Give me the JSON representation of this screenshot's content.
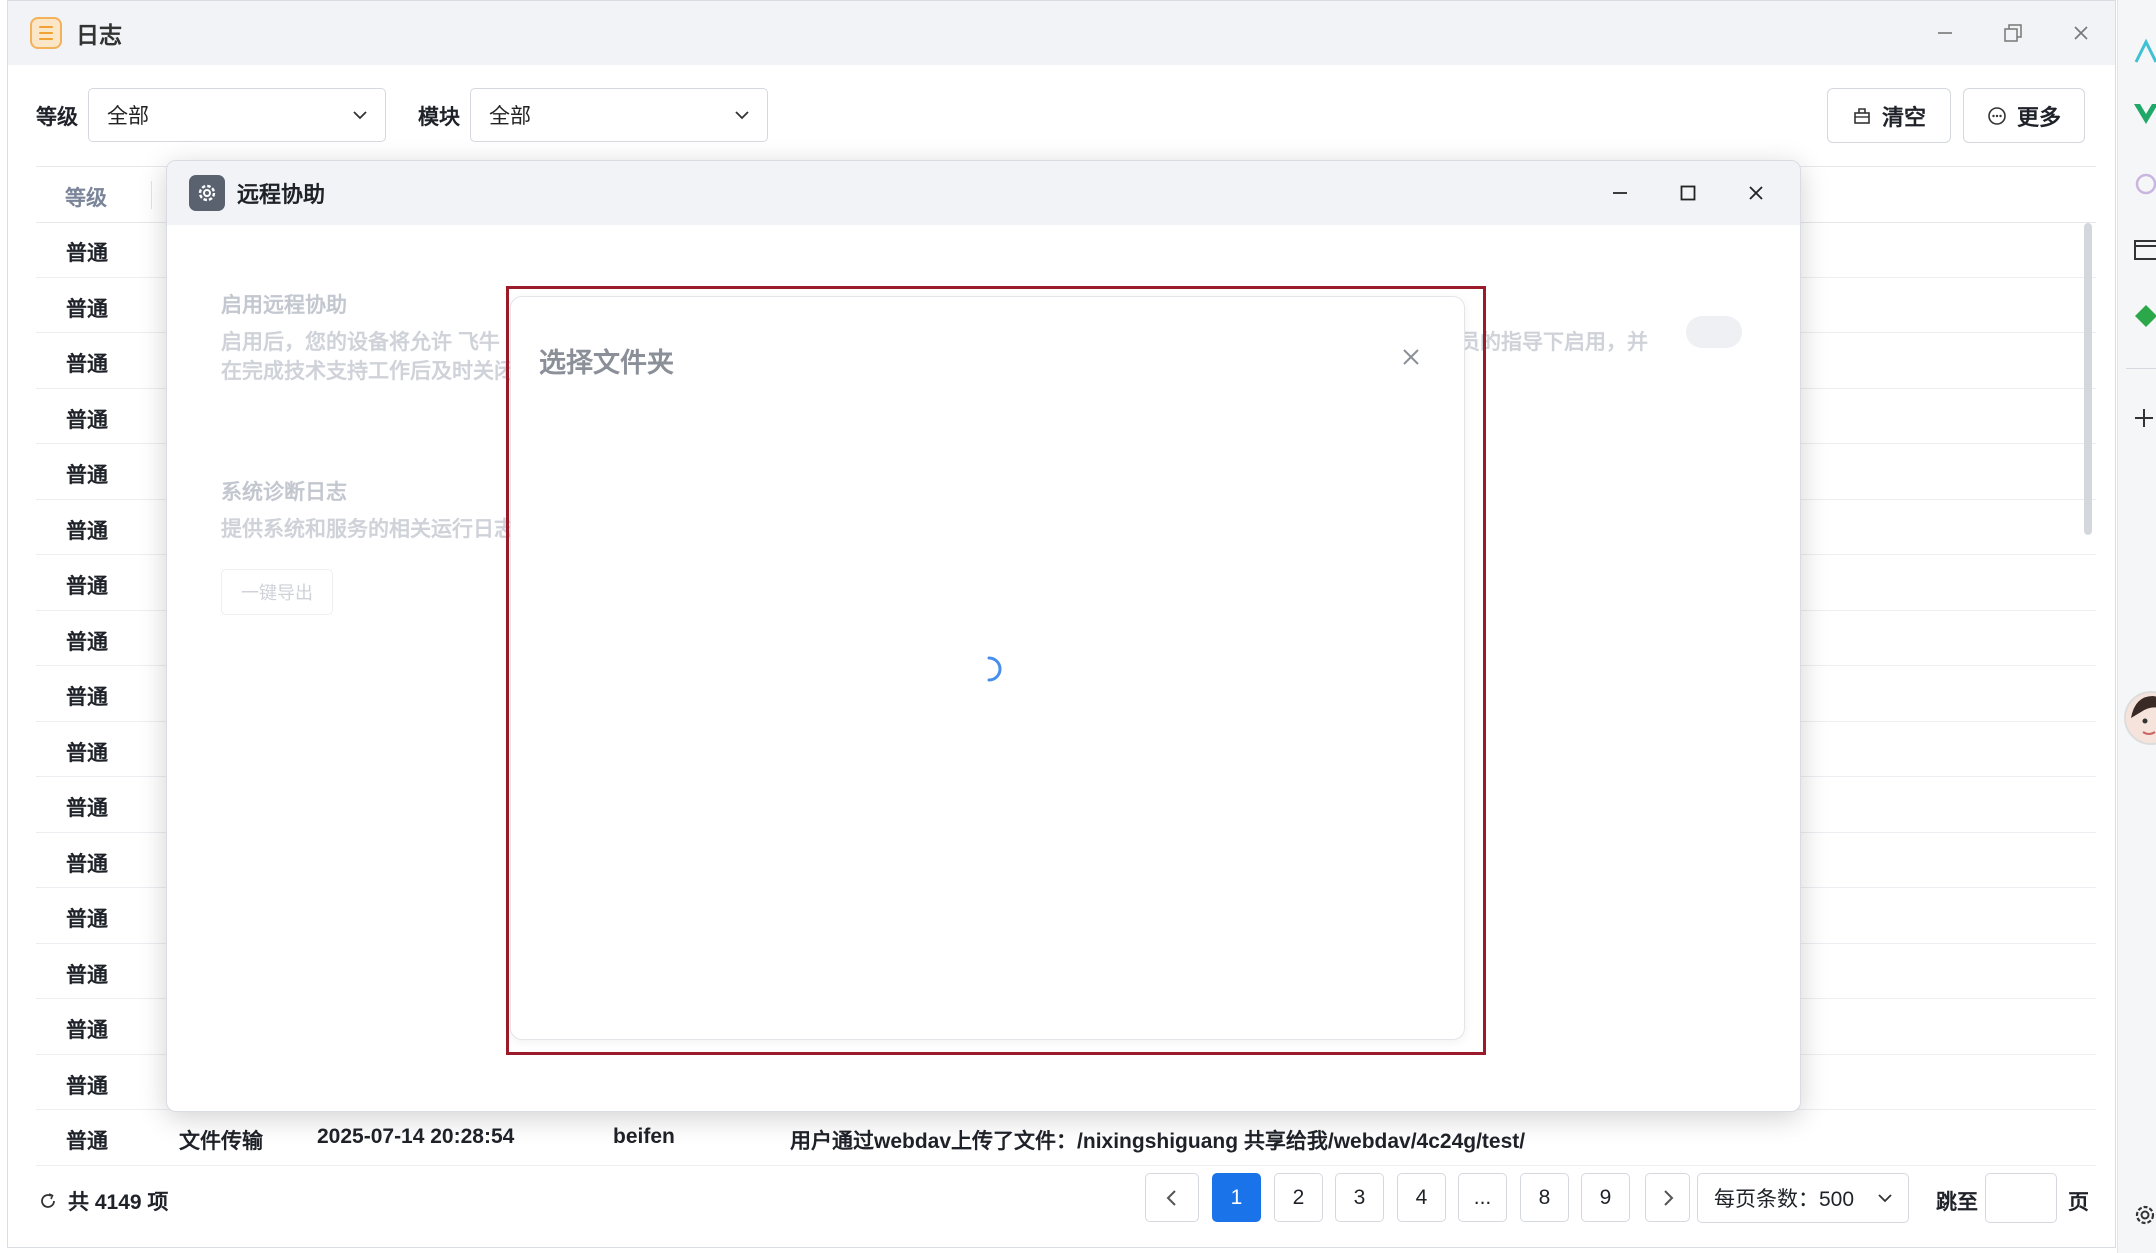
{
  "window": {
    "title": "日志"
  },
  "filters": {
    "level_label": "等级",
    "level_value": "全部",
    "module_label": "模块",
    "module_value": "全部",
    "clear_label": "清空",
    "more_label": "更多"
  },
  "table": {
    "header_level": "等级",
    "rows": [
      {
        "level": "普通"
      },
      {
        "level": "普通"
      },
      {
        "level": "普通"
      },
      {
        "level": "普通"
      },
      {
        "level": "普通"
      },
      {
        "level": "普通"
      },
      {
        "level": "普通"
      },
      {
        "level": "普通"
      },
      {
        "level": "普通"
      },
      {
        "level": "普通"
      },
      {
        "level": "普通"
      },
      {
        "level": "普通"
      },
      {
        "level": "普通"
      },
      {
        "level": "普通"
      },
      {
        "level": "普通"
      },
      {
        "level": "普通"
      },
      {
        "level": "普通",
        "module": "文件传输",
        "time": "2025-07-14 20:28:54",
        "user": "beifen",
        "message": "用户通过webdav上传了文件：/nixingshiguang 共享给我/webdav/4c24g/test/"
      }
    ]
  },
  "footer": {
    "total": "共 4149 项",
    "pages": [
      "1",
      "2",
      "3",
      "4",
      "...",
      "8",
      "9"
    ],
    "active_page": "1",
    "per_page": "每页条数：500",
    "jump_label": "跳至",
    "page_suffix": "页"
  },
  "assist": {
    "title": "远程协助",
    "enable_title": "启用远程协助",
    "enable_desc_left_1": "启用后，您的设备将允许 飞牛",
    "enable_desc_left_2": "在完成技术支持工作后及时关闭",
    "enable_desc_right": "员的指导下启用，并",
    "diag_title": "系统诊断日志",
    "diag_desc": "提供系统和服务的相关运行日志",
    "export_label": "一键导出"
  },
  "folder_dialog": {
    "title": "选择文件夹",
    "highlight_color": "#9b1b2a"
  },
  "colors": {
    "accent": "#1a73e8",
    "app_icon": "#f0a234"
  }
}
